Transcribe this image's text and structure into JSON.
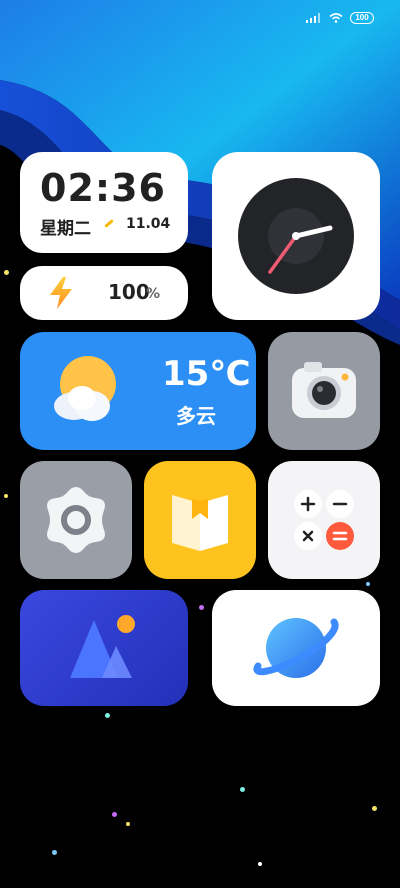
{
  "status_bar": {
    "battery": "100"
  },
  "clock_widget": {
    "time": "02:36",
    "weekday": "星期二",
    "date": "11.04"
  },
  "battery_widget": {
    "value": "100",
    "unit": "%"
  },
  "weather_widget": {
    "temperature": "15℃",
    "condition": "多云"
  },
  "apps": [
    {
      "name": "clock",
      "icon": "analog-clock-icon"
    },
    {
      "name": "camera",
      "icon": "camera-icon"
    },
    {
      "name": "settings",
      "icon": "gear-icon"
    },
    {
      "name": "books",
      "icon": "book-icon"
    },
    {
      "name": "calculator",
      "icon": "calculator-icon"
    },
    {
      "name": "gallery",
      "icon": "mountain-icon"
    },
    {
      "name": "browser",
      "icon": "planet-icon"
    }
  ],
  "colors": {
    "weather_bg": "#2b8ff5",
    "books_bg": "#ffc31f",
    "gallery_bg": "#2c3bd0",
    "clock_hand_accent": "#ef5b73"
  }
}
